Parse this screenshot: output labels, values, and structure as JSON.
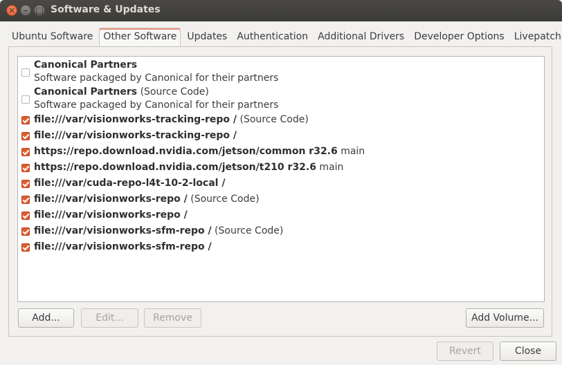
{
  "window": {
    "title": "Software & Updates"
  },
  "tabs": [
    {
      "label": "Ubuntu Software",
      "active": false
    },
    {
      "label": "Other Software",
      "active": true
    },
    {
      "label": "Updates",
      "active": false
    },
    {
      "label": "Authentication",
      "active": false
    },
    {
      "label": "Additional Drivers",
      "active": false
    },
    {
      "label": "Developer Options",
      "active": false
    },
    {
      "label": "Livepatch",
      "active": false
    }
  ],
  "sources": [
    {
      "checked": false,
      "main": "Canonical Partners",
      "suffix": "",
      "subtitle": "Software packaged by Canonical for their partners"
    },
    {
      "checked": false,
      "main": "Canonical Partners",
      "suffix": " (Source Code)",
      "subtitle": "Software packaged by Canonical for their partners"
    },
    {
      "checked": true,
      "main": "file:///var/visionworks-tracking-repo /",
      "suffix": " (Source Code)"
    },
    {
      "checked": true,
      "main": "file:///var/visionworks-tracking-repo /",
      "suffix": ""
    },
    {
      "checked": true,
      "main": "https://repo.download.nvidia.com/jetson/common r32.6",
      "suffix": " main"
    },
    {
      "checked": true,
      "main": "https://repo.download.nvidia.com/jetson/t210 r32.6",
      "suffix": " main"
    },
    {
      "checked": true,
      "main": "file:///var/cuda-repo-l4t-10-2-local /",
      "suffix": ""
    },
    {
      "checked": true,
      "main": "file:///var/visionworks-repo /",
      "suffix": " (Source Code)"
    },
    {
      "checked": true,
      "main": "file:///var/visionworks-repo /",
      "suffix": ""
    },
    {
      "checked": true,
      "main": "file:///var/visionworks-sfm-repo /",
      "suffix": " (Source Code)"
    },
    {
      "checked": true,
      "main": "file:///var/visionworks-sfm-repo /",
      "suffix": ""
    }
  ],
  "buttons": {
    "add": "Add...",
    "edit": "Edit...",
    "remove": "Remove",
    "add_volume": "Add Volume...",
    "revert": "Revert",
    "close": "Close"
  },
  "colors": {
    "accent": "#e05d2f",
    "titlebar": "#3c3b37"
  }
}
